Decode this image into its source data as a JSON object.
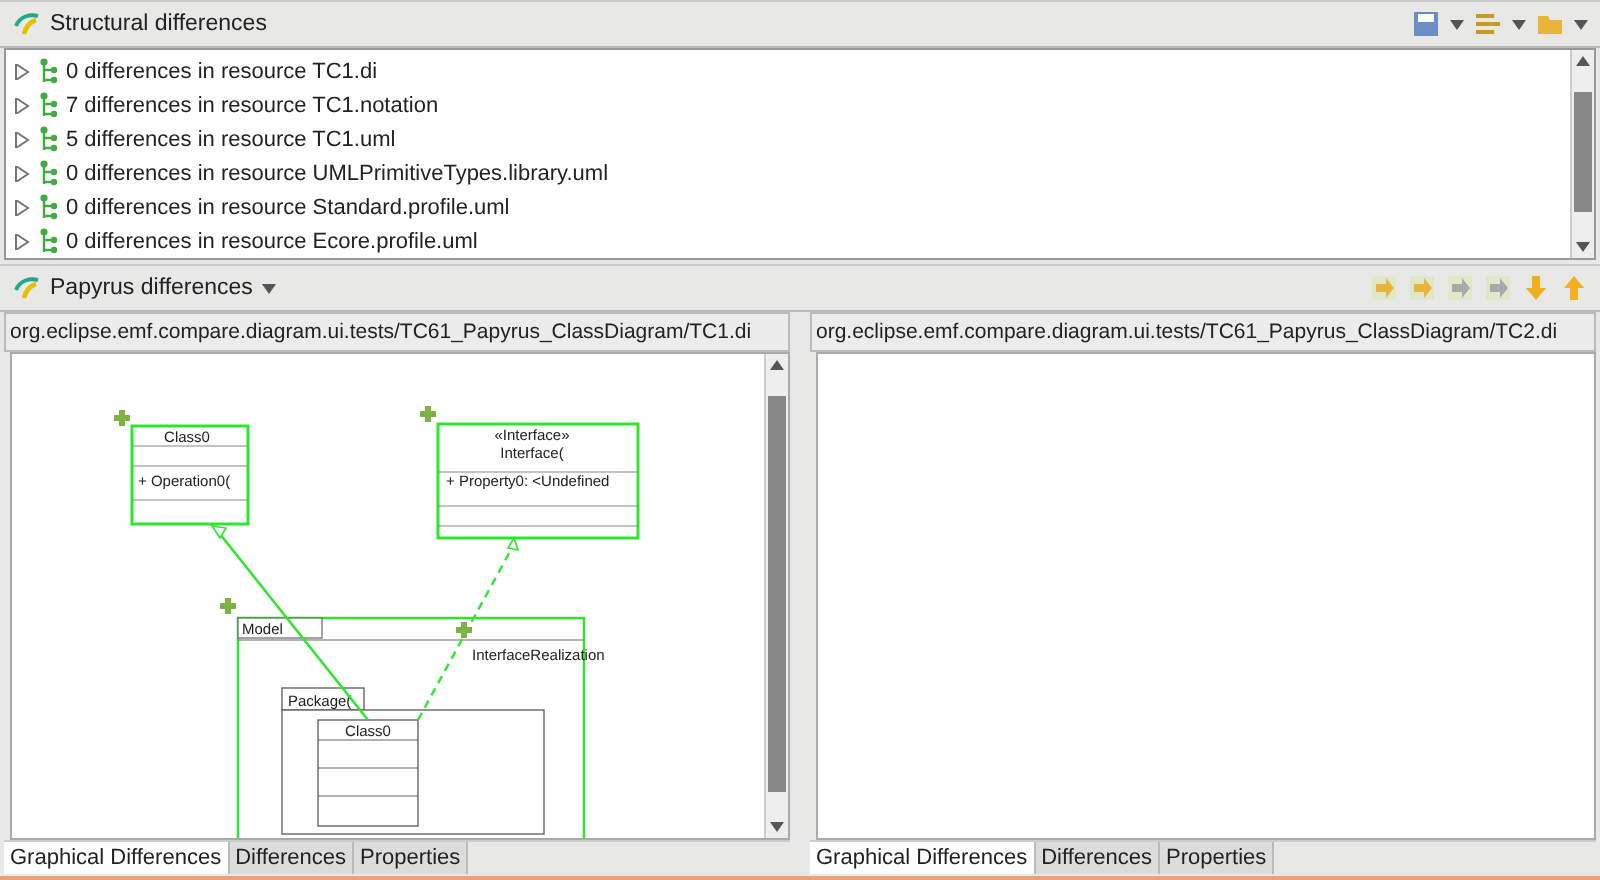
{
  "structural": {
    "title": "Structural differences",
    "rows": [
      {
        "label": "0 differences in resource TC1.di",
        "expanded": false
      },
      {
        "label": "7 differences in resource TC1.notation",
        "expanded": false
      },
      {
        "label": "5 differences in resource TC1.uml",
        "expanded": false
      },
      {
        "label": "0 differences in resource UMLPrimitiveTypes.library.uml",
        "expanded": false
      },
      {
        "label": "0 differences in resource Standard.profile.uml",
        "expanded": false
      },
      {
        "label": "0 differences in resource Ecore.profile.uml",
        "expanded": false
      }
    ]
  },
  "papyrus": {
    "title": "Papyrus differences",
    "panes": [
      {
        "path": "org.eclipse.emf.compare.diagram.ui.tests/TC61_Papyrus_ClassDiagram/TC1.di",
        "diagram": {
          "class_top": {
            "name": "Class0",
            "operation": "+ Operation0("
          },
          "interface": {
            "stereotype": "«Interface»",
            "name": "Interface(",
            "property": "+ Property0: <Undefined"
          },
          "model": {
            "name": "Model"
          },
          "package": {
            "name": "Package("
          },
          "class_inner": {
            "name": "Class0"
          },
          "realization_label": "InterfaceRealization"
        },
        "tabs": [
          {
            "label": "Graphical Differences",
            "selected": true
          },
          {
            "label": "Differences",
            "selected": false
          },
          {
            "label": "Properties",
            "selected": false
          }
        ]
      },
      {
        "path": "org.eclipse.emf.compare.diagram.ui.tests/TC61_Papyrus_ClassDiagram/TC2.di",
        "tabs": [
          {
            "label": "Graphical Differences",
            "selected": true
          },
          {
            "label": "Differences",
            "selected": false
          },
          {
            "label": "Properties",
            "selected": false
          }
        ]
      }
    ]
  }
}
